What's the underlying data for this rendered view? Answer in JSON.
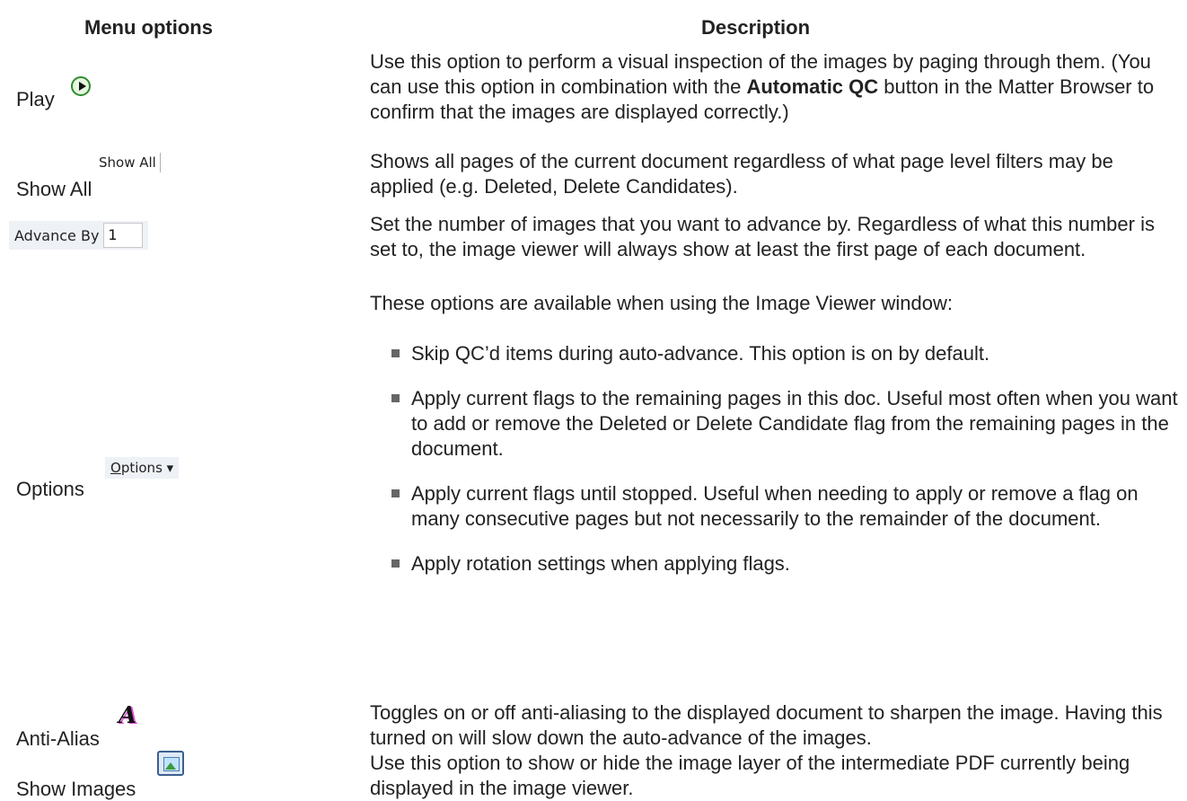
{
  "headers": {
    "menu": "Menu options",
    "description": "Description"
  },
  "rows": {
    "play": {
      "label": "Play",
      "icon": "play-icon",
      "description_before": "Use this option to perform a visual inspection of the images by paging through them. (You can use this option in combination with the ",
      "description_bold": "Automatic QC",
      "description_after": " button in the Matter Browser to confirm that the images are displayed correctly.)"
    },
    "show_all": {
      "label": "Show All",
      "button_text": "Show All",
      "description": "Shows all pages of the current document regardless of what page level filters may be applied (e.g. Deleted, Delete Candidates)."
    },
    "advance_by": {
      "control_label": "Advance By",
      "value": "1",
      "description": "Set the number of images that you want to advance by. Regardless of what this number is set to, the image viewer will always show at least the first page of each document."
    },
    "options": {
      "label": "Options",
      "button_mnemonic": "O",
      "button_rest": "ptions",
      "dropdown_glyph": "▾",
      "intro": "These options are available when using the Image Viewer window:",
      "bullets": [
        "Skip QC’d items during auto-advance. This option is on by default.",
        "Apply current flags to the remaining pages in this doc. Useful most often when you want to add or remove the Deleted or Delete Candidate flag from the remaining pages in the document.",
        "Apply current flags until stopped. Useful when needing to apply or remove a flag on many consecutive pages but not necessarily to the remainder of the document.",
        "Apply rotation settings when applying flags."
      ]
    },
    "anti_alias": {
      "label": "Anti-Alias",
      "icon_glyph": "A",
      "description": "Toggles on or off anti-aliasing to the displayed document to sharpen the image. Having this turned on will slow down the auto-advance of the images."
    },
    "show_images": {
      "label": "Show Images",
      "icon": "image-icon",
      "description": "Use this option to show or hide the image layer of the intermediate PDF currently being displayed in the image viewer."
    }
  }
}
